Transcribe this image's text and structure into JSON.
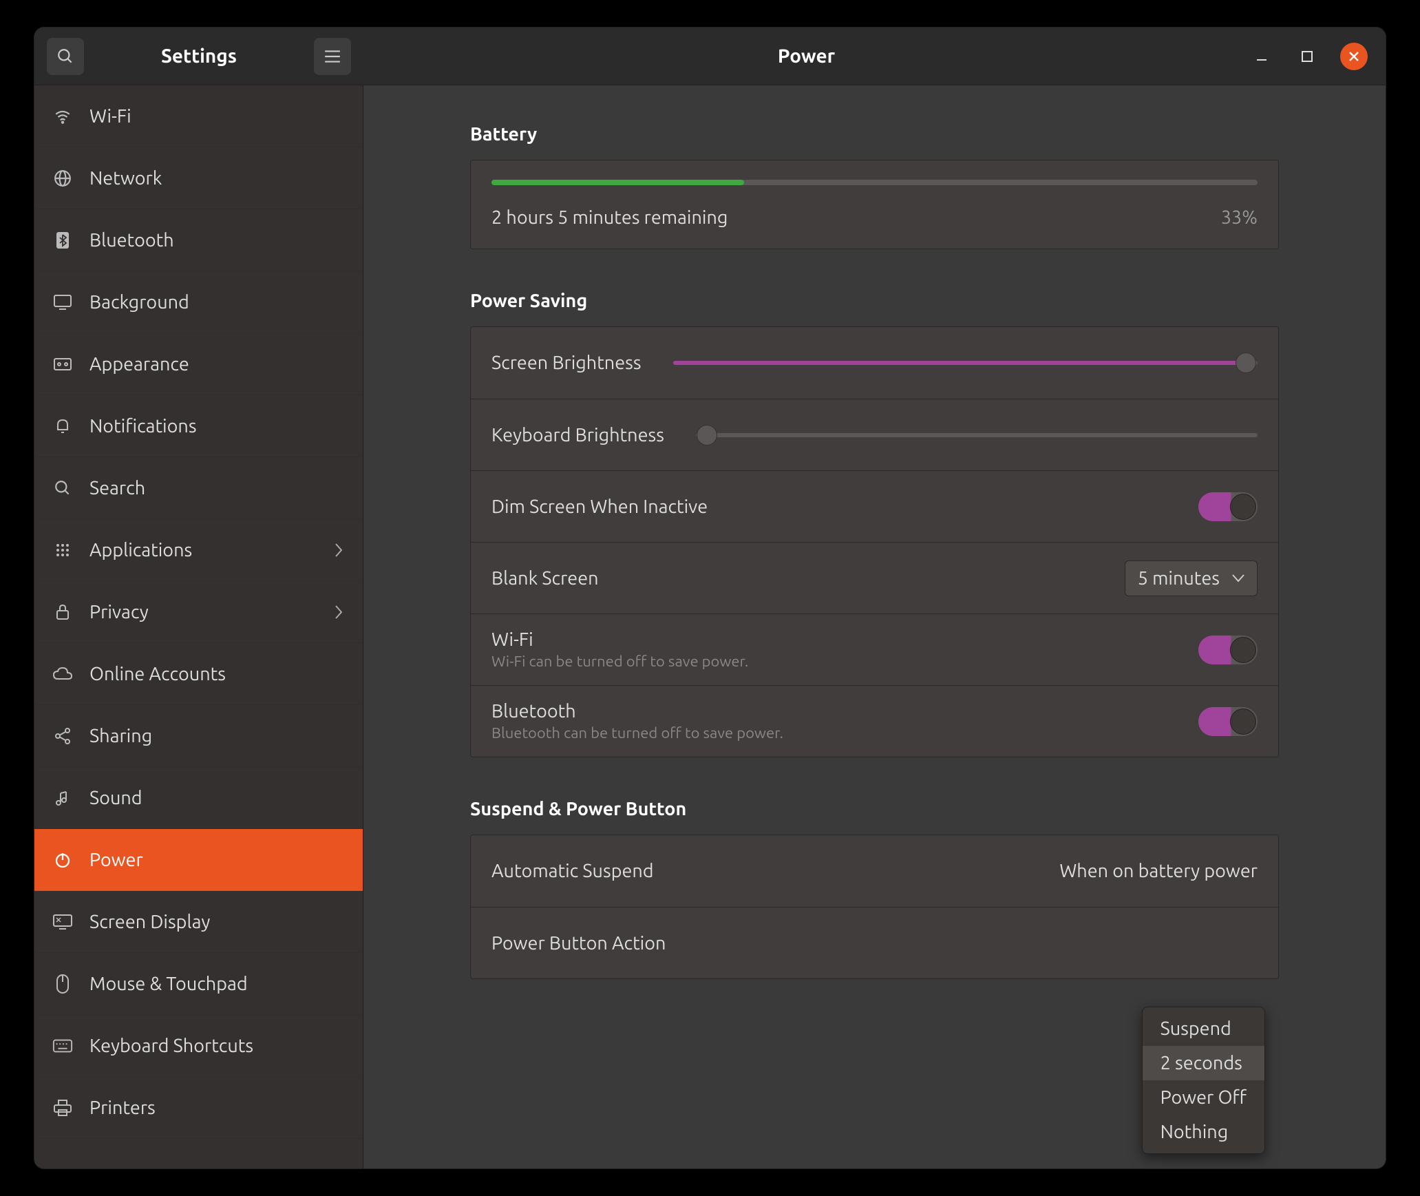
{
  "app_title": "Settings",
  "page_title": "Power",
  "sidebar": {
    "items": [
      {
        "label": "Wi-Fi",
        "icon": "wifi"
      },
      {
        "label": "Network",
        "icon": "globe"
      },
      {
        "label": "Bluetooth",
        "icon": "bluetooth"
      },
      {
        "label": "Background",
        "icon": "display"
      },
      {
        "label": "Appearance",
        "icon": "appearance"
      },
      {
        "label": "Notifications",
        "icon": "bell"
      },
      {
        "label": "Search",
        "icon": "search"
      },
      {
        "label": "Applications",
        "icon": "grid",
        "chevron": true
      },
      {
        "label": "Privacy",
        "icon": "lock",
        "chevron": true
      },
      {
        "label": "Online Accounts",
        "icon": "cloud"
      },
      {
        "label": "Sharing",
        "icon": "share"
      },
      {
        "label": "Sound",
        "icon": "sound"
      },
      {
        "label": "Power",
        "icon": "power",
        "active": true
      },
      {
        "label": "Screen Display",
        "icon": "screen"
      },
      {
        "label": "Mouse & Touchpad",
        "icon": "mouse"
      },
      {
        "label": "Keyboard Shortcuts",
        "icon": "keyboard"
      },
      {
        "label": "Printers",
        "icon": "printer"
      }
    ]
  },
  "battery": {
    "section_title": "Battery",
    "remaining_text": "2 hours 5 minutes remaining",
    "percent_text": "33%",
    "percent_value": 33
  },
  "power_saving": {
    "section_title": "Power Saving",
    "screen_brightness_label": "Screen Brightness",
    "screen_brightness_value": 98,
    "keyboard_brightness_label": "Keyboard Brightness",
    "keyboard_brightness_value": 2,
    "dim_label": "Dim Screen When Inactive",
    "dim_on": true,
    "blank_label": "Blank Screen",
    "blank_value": "5 minutes",
    "wifi_label": "Wi-Fi",
    "wifi_sub": "Wi-Fi can be turned off to save power.",
    "wifi_on": true,
    "bt_label": "Bluetooth",
    "bt_sub": "Bluetooth can be turned off to save power.",
    "bt_on": true
  },
  "suspend": {
    "section_title": "Suspend & Power Button",
    "auto_suspend_label": "Automatic Suspend",
    "auto_suspend_value": "When on battery power",
    "power_button_label": "Power Button Action",
    "menu_items": [
      "Suspend",
      "2 seconds",
      "Power Off",
      "Nothing"
    ],
    "menu_hovered_index": 1
  }
}
